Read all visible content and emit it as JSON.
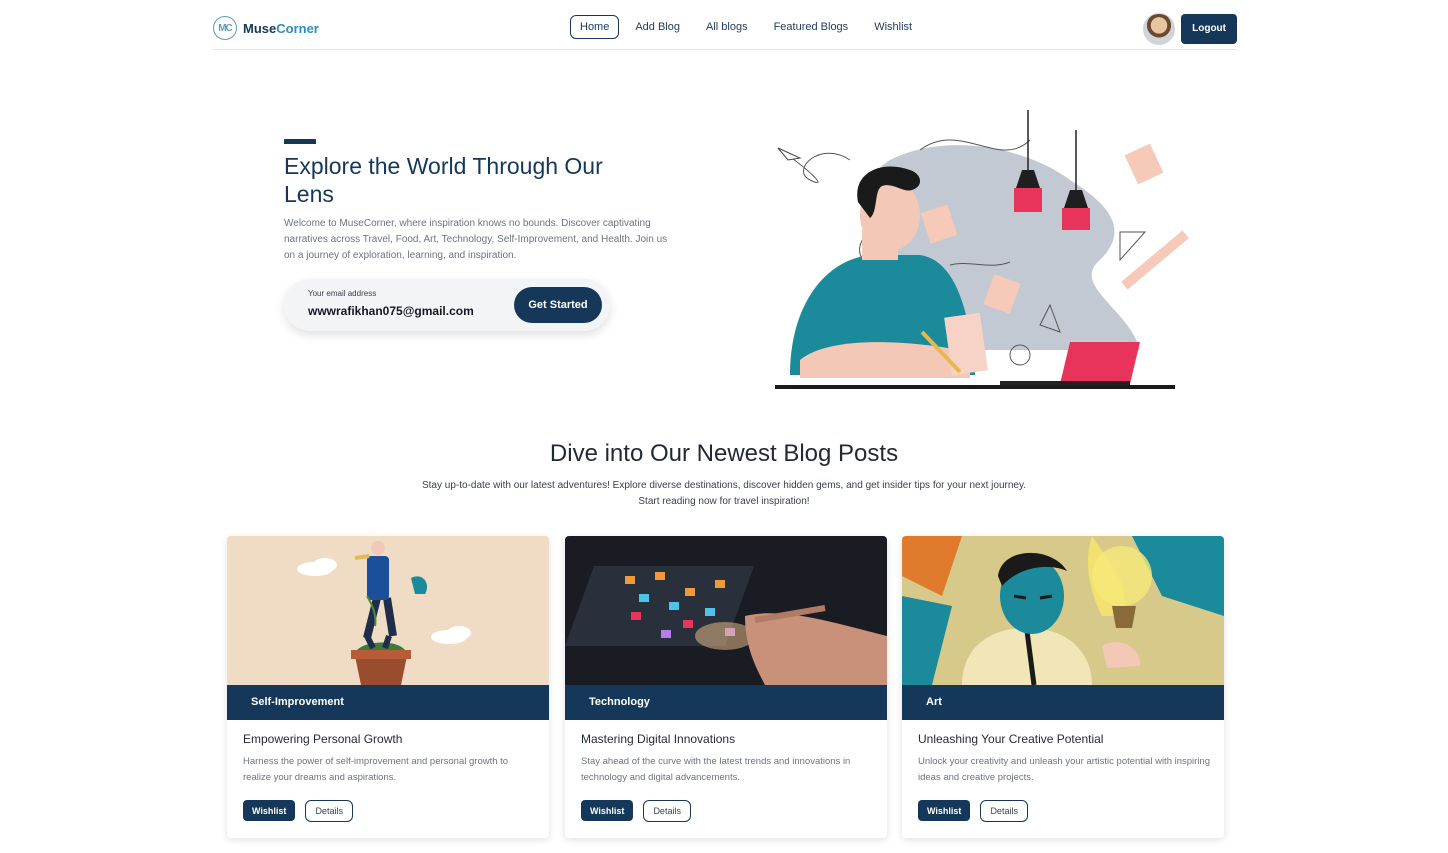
{
  "brand": {
    "logo_text": "MC",
    "name_part1": "Muse",
    "name_part2": "Corner"
  },
  "nav": {
    "links": [
      {
        "label": "Home",
        "active": true
      },
      {
        "label": "Add Blog",
        "active": false
      },
      {
        "label": "All blogs",
        "active": false
      },
      {
        "label": "Featured Blogs",
        "active": false
      },
      {
        "label": "Wishlist",
        "active": false
      }
    ],
    "logout_label": "Logout"
  },
  "hero": {
    "title": "Explore the World Through Our Lens",
    "description": "Welcome to MuseCorner, where inspiration knows no bounds. Discover captivating narratives across Travel, Food, Art, Technology, Self-Improvement, and Health. Join us on a journey of exploration, learning, and inspiration.",
    "email_label": "Your email address",
    "email_value": "wwwrafikhan075@gmail.com",
    "cta_label": "Get Started"
  },
  "section": {
    "title": "Dive into Our Newest Blog Posts",
    "description_line1": "Stay up-to-date with our latest adventures! Explore diverse destinations, discover hidden gems, and get insider tips for your next journey.",
    "description_line2": "Start reading now for travel inspiration!"
  },
  "cards": [
    {
      "category": "Self-Improvement",
      "title": "Empowering Personal Growth",
      "description": "Harness the power of self-improvement and personal growth to realize your dreams and aspirations.",
      "wishlist_label": "Wishlist",
      "details_label": "Details"
    },
    {
      "category": "Technology",
      "title": "Mastering Digital Innovations",
      "description": "Stay ahead of the curve with the latest trends and innovations in technology and digital advancements.",
      "wishlist_label": "Wishlist",
      "details_label": "Details"
    },
    {
      "category": "Art",
      "title": "Unleashing Your Creative Potential",
      "description": "Unlock your creativity and unleash your artistic potential with inspiring ideas and creative projects.",
      "wishlist_label": "Wishlist",
      "details_label": "Details"
    }
  ],
  "colors": {
    "primary": "#14375a",
    "accent": "#2a8fc4",
    "illustration_pink": "#e8335a",
    "illustration_teal": "#1b8a9a"
  }
}
